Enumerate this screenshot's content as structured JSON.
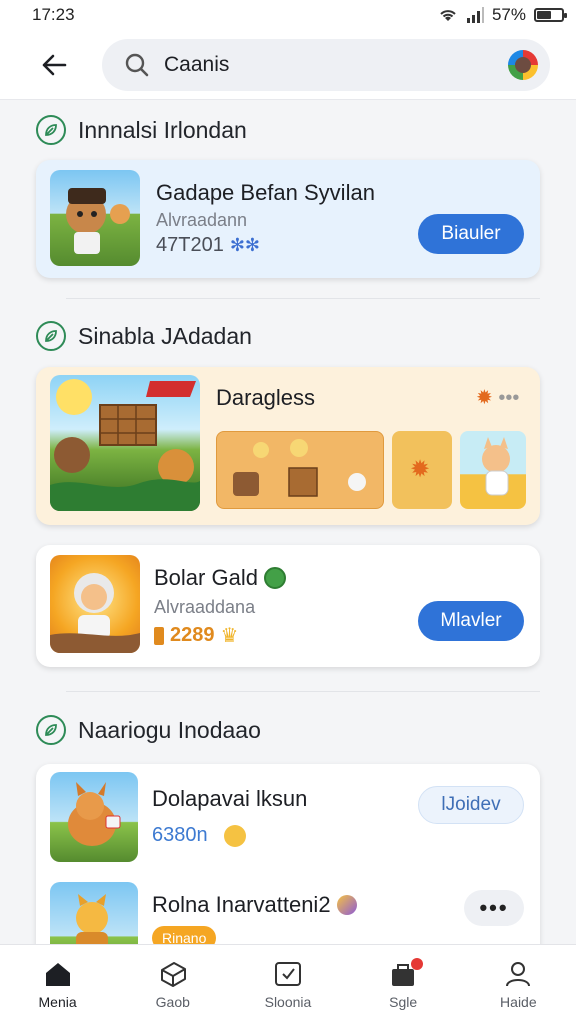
{
  "status": {
    "time": "17:23",
    "battery": "57%",
    "battery_level": 0.57
  },
  "search": {
    "value": "Caanis",
    "placeholder": ""
  },
  "sections": [
    {
      "title": "Innnalsi Irlondan"
    },
    {
      "title": "Sinabla JAdadan"
    },
    {
      "title": "Naariogu Inodaao"
    }
  ],
  "apps": {
    "featured": {
      "title": "Gadape Befan Syvilan",
      "subtitle": "Alvraadann",
      "meta": "47T201",
      "button": "Biauler"
    },
    "promo": {
      "title": "Daragless"
    },
    "bolar": {
      "title": "Bolar Gald",
      "subtitle": "Alvraaddana",
      "meta": "2289",
      "button": "Mlavler"
    },
    "dolapa": {
      "title": "Dolapavai lksun",
      "meta": "6380n",
      "button": "lJoidev"
    },
    "rolna": {
      "title": "Rolna Inarvatteni2",
      "tag": "Rinano"
    }
  },
  "nav": [
    {
      "label": "Menia",
      "icon": "home-icon"
    },
    {
      "label": "Gaob",
      "icon": "games-icon"
    },
    {
      "label": "Sloonia",
      "icon": "store-icon"
    },
    {
      "label": "Sgle",
      "icon": "bag-icon"
    },
    {
      "label": "Haide",
      "icon": "profile-icon"
    }
  ],
  "colors": {
    "accent": "#2f73d8",
    "section_icon": "#2e8b57",
    "badge": "#e53935"
  }
}
